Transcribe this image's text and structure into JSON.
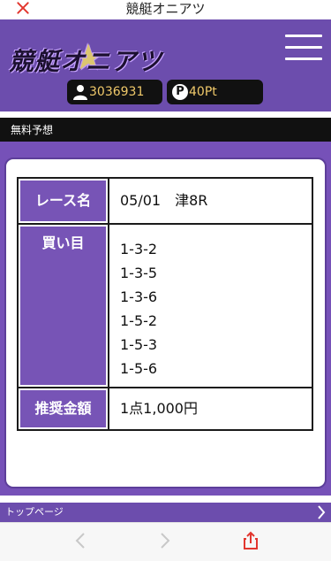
{
  "topbar": {
    "title": "競艇オニアツ"
  },
  "header": {
    "logo_text": "競艇オニアツ",
    "user_id": "3036931",
    "points_icon_letter": "P",
    "points": "40Pt"
  },
  "section": {
    "title": "無料予想"
  },
  "prediction": {
    "race_label": "レース名",
    "race_value": "05/01　津8R",
    "bets_label": "買い目",
    "bets": [
      "1-3-2",
      "1-3-5",
      "1-3-6",
      "1-5-2",
      "1-5-3",
      "1-5-6"
    ],
    "amount_label": "推奨金額",
    "amount_value": "1点1,000円"
  },
  "footer": {
    "top_page_label": "トップページ"
  },
  "colors": {
    "brand_purple": "#6c4dad",
    "header_cell": "#7754b6",
    "badge_text": "#f0c96a",
    "close_red": "#e2372f"
  },
  "icons": {
    "close": "close-icon",
    "menu": "hamburger-menu-icon",
    "user": "user-icon",
    "points": "points-icon",
    "chevron": "chevron-right-icon",
    "back": "back-arrow-icon",
    "forward": "forward-arrow-icon",
    "share": "share-icon"
  }
}
